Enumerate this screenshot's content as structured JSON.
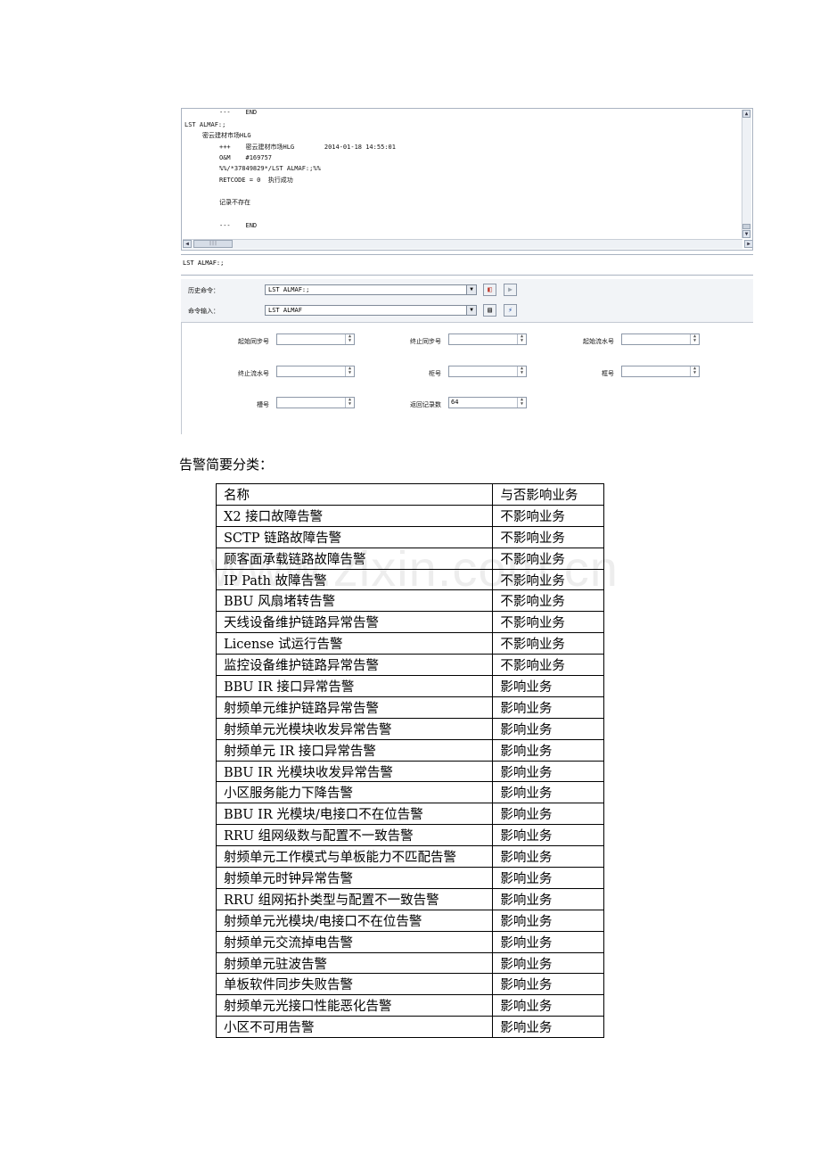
{
  "terminal": {
    "output_lines": [
      "---    END",
      "LST ALMAF:;",
      "密云建材市场HLG",
      "+++    密云建材市场HLG        2014-01-18 14:55:01",
      "O&M    #169757",
      "%%/*37849829*/LST ALMAF:;%%",
      "RETCODE = 0  执行成功",
      "记录不存在",
      "---    END"
    ],
    "hscroll_thumb": "|||"
  },
  "command_line": "LST ALMAF:;",
  "form": {
    "history_label": "历史命令：",
    "history_value": "LST ALMAF:;",
    "input_label": "命令输入：",
    "input_value": "LST ALMAF",
    "params": [
      {
        "label": "起始同步号",
        "value": ""
      },
      {
        "label": "终止同步号",
        "value": ""
      },
      {
        "label": "起始流水号",
        "value": ""
      },
      {
        "label": "终止流水号",
        "value": ""
      },
      {
        "label": "柜号",
        "value": ""
      },
      {
        "label": "框号",
        "value": ""
      },
      {
        "label": "槽号",
        "value": ""
      },
      {
        "label": "返回记录数",
        "value": "64"
      }
    ]
  },
  "caption": "告警简要分类：",
  "watermark": "www.zixin.com.cn",
  "table": {
    "headers": [
      "名称",
      "与否影响业务"
    ],
    "rows": [
      [
        "X2 接口故障告警",
        "不影响业务"
      ],
      [
        "SCTP 链路故障告警",
        "不影响业务"
      ],
      [
        "顾客面承载链路故障告警",
        "不影响业务"
      ],
      [
        "IP Path 故障告警",
        "不影响业务"
      ],
      [
        "BBU 风扇堵转告警",
        "不影响业务"
      ],
      [
        "天线设备维护链路异常告警",
        "不影响业务"
      ],
      [
        "License 试运行告警",
        "不影响业务"
      ],
      [
        "监控设备维护链路异常告警",
        "不影响业务"
      ],
      [
        "BBU IR 接口异常告警",
        "影响业务"
      ],
      [
        "射频单元维护链路异常告警",
        "影响业务"
      ],
      [
        "射频单元光模块收发异常告警",
        "影响业务"
      ],
      [
        "射频单元 IR 接口异常告警",
        "影响业务"
      ],
      [
        "BBU IR 光模块收发异常告警",
        "影响业务"
      ],
      [
        "小区服务能力下降告警",
        "影响业务"
      ],
      [
        "BBU IR 光模块/电接口不在位告警",
        "影响业务"
      ],
      [
        "RRU 组网级数与配置不一致告警",
        "影响业务"
      ],
      [
        "射频单元工作模式与单板能力不匹配告警",
        "影响业务"
      ],
      [
        "射频单元时钟异常告警",
        "影响业务"
      ],
      [
        "RRU 组网拓扑类型与配置不一致告警",
        "影响业务"
      ],
      [
        "射频单元光模块/电接口不在位告警",
        "影响业务"
      ],
      [
        "射频单元交流掉电告警",
        "影响业务"
      ],
      [
        "射频单元驻波告警",
        "影响业务"
      ],
      [
        "单板软件同步失败告警",
        "影响业务"
      ],
      [
        "射频单元光接口性能恶化告警",
        "影响业务"
      ],
      [
        "小区不可用告警",
        "影响业务"
      ]
    ]
  }
}
